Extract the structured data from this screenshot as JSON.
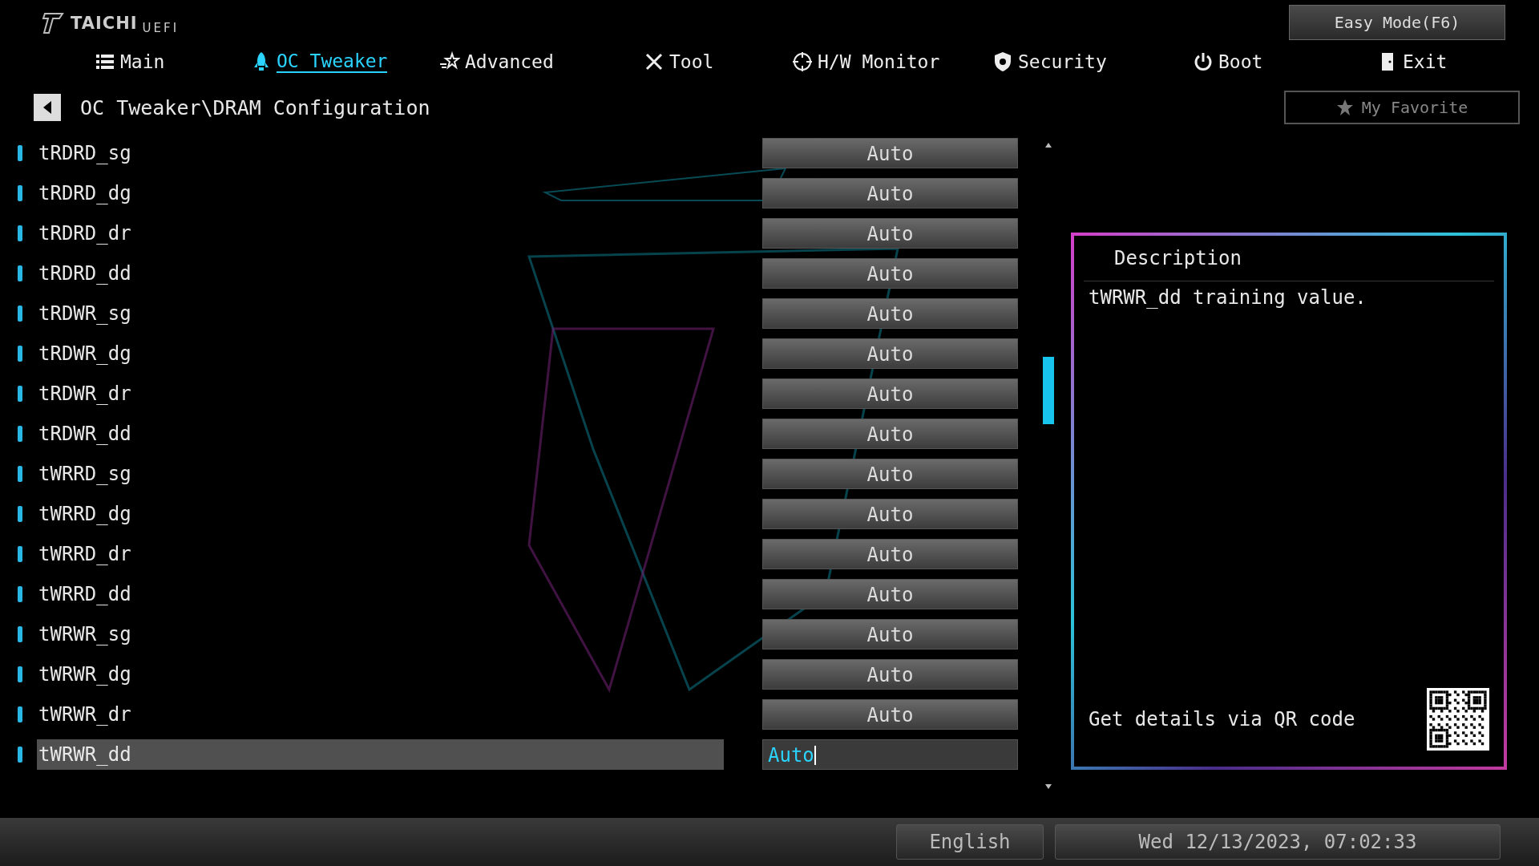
{
  "logo": {
    "name": "TAICHI",
    "suffix": "UEFI"
  },
  "easy_mode": "Easy Mode(F6)",
  "tabs": [
    {
      "label": "Main",
      "selected": false
    },
    {
      "label": "OC Tweaker",
      "selected": true
    },
    {
      "label": "Advanced",
      "selected": false
    },
    {
      "label": "Tool",
      "selected": false
    },
    {
      "label": "H/W Monitor",
      "selected": false
    },
    {
      "label": "Security",
      "selected": false
    },
    {
      "label": "Boot",
      "selected": false
    },
    {
      "label": "Exit",
      "selected": false
    }
  ],
  "breadcrumb": "OC Tweaker\\DRAM Configuration",
  "favorite": "My Favorite",
  "items": [
    {
      "name": "tRDRD_sg",
      "value": "Auto",
      "selected": false
    },
    {
      "name": "tRDRD_dg",
      "value": "Auto",
      "selected": false
    },
    {
      "name": "tRDRD_dr",
      "value": "Auto",
      "selected": false
    },
    {
      "name": "tRDRD_dd",
      "value": "Auto",
      "selected": false
    },
    {
      "name": "tRDWR_sg",
      "value": "Auto",
      "selected": false
    },
    {
      "name": "tRDWR_dg",
      "value": "Auto",
      "selected": false
    },
    {
      "name": "tRDWR_dr",
      "value": "Auto",
      "selected": false
    },
    {
      "name": "tRDWR_dd",
      "value": "Auto",
      "selected": false
    },
    {
      "name": "tWRRD_sg",
      "value": "Auto",
      "selected": false
    },
    {
      "name": "tWRRD_dg",
      "value": "Auto",
      "selected": false
    },
    {
      "name": "tWRRD_dr",
      "value": "Auto",
      "selected": false
    },
    {
      "name": "tWRRD_dd",
      "value": "Auto",
      "selected": false
    },
    {
      "name": "tWRWR_sg",
      "value": "Auto",
      "selected": false
    },
    {
      "name": "tWRWR_dg",
      "value": "Auto",
      "selected": false
    },
    {
      "name": "tWRWR_dr",
      "value": "Auto",
      "selected": false
    },
    {
      "name": "tWRWR_dd",
      "value": "Auto",
      "selected": true
    }
  ],
  "description": {
    "title": "Description",
    "text": "tWRWR_dd training value.",
    "qr_text": "Get details via QR code"
  },
  "status_bar": {
    "language": "English",
    "datetime": "Wed 12/13/2023, 07:02:33"
  }
}
